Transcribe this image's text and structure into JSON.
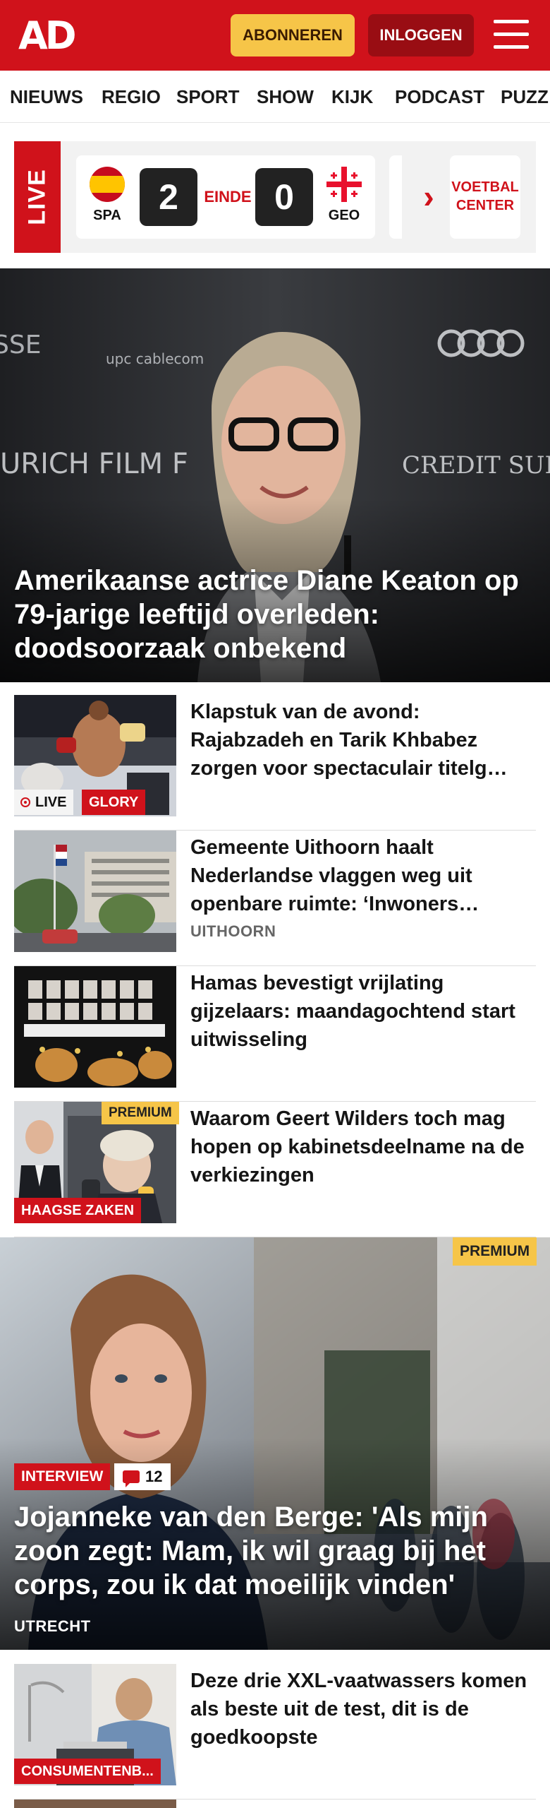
{
  "header": {
    "logo": "AD",
    "subscribe_label": "ABONNEREN",
    "login_label": "INLOGGEN",
    "brand_color": "#d0121b"
  },
  "nav": {
    "items": [
      "NIEUWS",
      "REGIO",
      "SPORT",
      "SHOW",
      "KIJK",
      "PODCAST",
      "PUZZ"
    ]
  },
  "live_widget": {
    "live_label": "LIVE",
    "home_team": "SPA",
    "away_team": "GEO",
    "home_score": "2",
    "away_score": "0",
    "status": "EINDE",
    "voetbal_center_line1": "VOETBAL",
    "voetbal_center_line2": "CENTER"
  },
  "hero": {
    "title": "Amerikaanse actrice Diane Keaton op 79-jarige leeftijd overleden: doodsoorzaak onbekend"
  },
  "articles": [
    {
      "title": "Klapstuk van de avond: Rajabzadeh en Tarik Khbabez zorgen voor spectaculair titelg…",
      "live_label": "LIVE",
      "tag": "GLORY"
    },
    {
      "title": "Gemeente Uithoorn haalt Nederlandse vlaggen weg uit openbare ruimte: ‘Inwoners…",
      "subtitle": "UITHOORN"
    },
    {
      "title": "Hamas bevestigt vrijlating gijzelaars: maandagochtend start uitwisseling"
    },
    {
      "title": "Waarom Geert Wilders toch mag hopen op kabinetsdeelname na de verkiezingen",
      "premium_label": "PREMIUM",
      "tag": "HAAGSE ZAKEN"
    }
  ],
  "feature": {
    "premium_label": "PREMIUM",
    "tag": "INTERVIEW",
    "comment_count": "12",
    "title": "Jojanneke van den Berge: 'Als mijn zoon zegt: Mam, ik wil graag bij het corps, zou ik dat moeilijk vinden'",
    "location": "UTRECHT"
  },
  "articles_2": [
    {
      "title": "Deze drie XXL-vaatwassers komen als beste uit de test, dit is de goedkoopste",
      "tag": "CONSUMENTENB..."
    }
  ]
}
